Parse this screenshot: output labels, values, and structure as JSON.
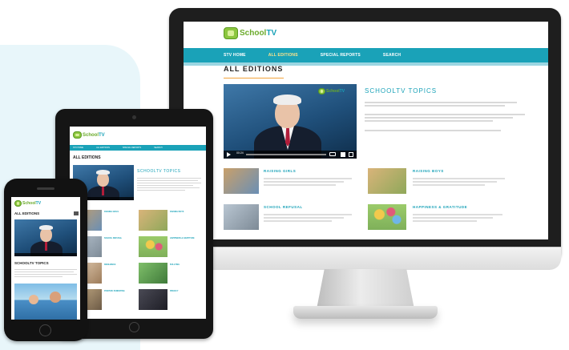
{
  "brand": {
    "logo_prefix": "School",
    "logo_suffix": "TV",
    "accent_color": "#1aa2b8",
    "logo_green": "#8cc63f"
  },
  "nav": {
    "items": [
      "STV HOME",
      "ALL EDITIONS",
      "SPECIAL REPORTS",
      "SEARCH"
    ],
    "active_index": 1
  },
  "page": {
    "title": "ALL EDITIONS",
    "topics_heading": "SCHOOLTV TOPICS"
  },
  "topics": [
    {
      "title": "RAISING GIRLS",
      "thumb_color": "#c9a06a",
      "thumb_color2": "#6a8fb5"
    },
    {
      "title": "RAISING BOYS",
      "thumb_color": "#d9b47a",
      "thumb_color2": "#8fa85a"
    },
    {
      "title": "SCHOOL REFUSAL",
      "thumb_color": "#b9c6d2",
      "thumb_color2": "#7d8a96"
    },
    {
      "title": "HAPPINESS & GRATITUDE",
      "thumb_color": "#f2c94c",
      "thumb_color2": "#9bcb6a"
    }
  ],
  "tablet_topics": [
    {
      "title": "RAISING GIRLS"
    },
    {
      "title": "RAISING BOYS"
    },
    {
      "title": "SCHOOL REFUSAL"
    },
    {
      "title": "HAPPINESS & GRATITUDE"
    },
    {
      "title": "RESILIENCE"
    },
    {
      "title": "BULLYING"
    },
    {
      "title": "POSITIVE PARENTING"
    },
    {
      "title": "PRIVACY"
    }
  ],
  "video": {
    "time": "00:24"
  }
}
